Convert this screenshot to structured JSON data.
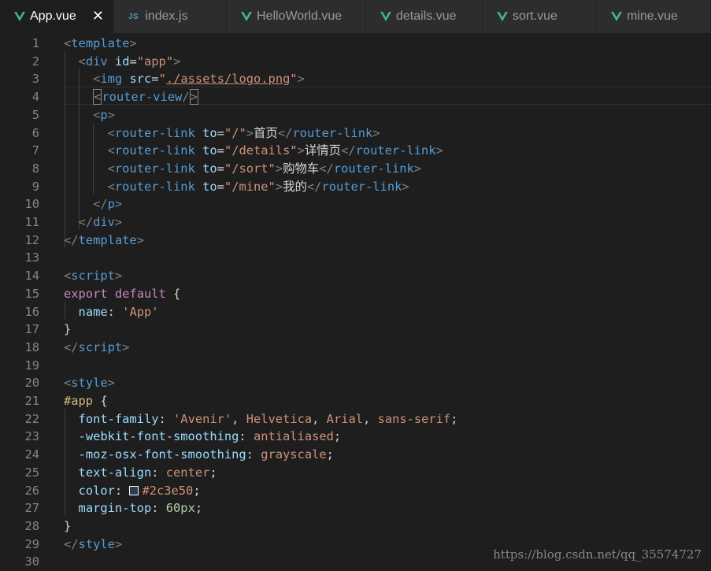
{
  "tabs": [
    {
      "label": "App.vue",
      "icon": "vue-icon",
      "active": true
    },
    {
      "label": "index.js",
      "icon": "js-icon",
      "icon_text": "JS",
      "active": false
    },
    {
      "label": "HelloWorld.vue",
      "icon": "vue-icon",
      "active": false
    },
    {
      "label": "details.vue",
      "icon": "vue-icon",
      "active": false
    },
    {
      "label": "sort.vue",
      "icon": "vue-icon",
      "active": false
    },
    {
      "label": "mine.vue",
      "icon": "vue-icon",
      "active": false
    }
  ],
  "close_glyph": "✕",
  "colors": {
    "vue_green": "#41b883",
    "editor_bg": "#1e1e1e",
    "tag_blue": "#569cd6",
    "attr_cyan": "#9cdcfe",
    "string_orange": "#ce9178",
    "keyword_pink": "#c586c0",
    "number_green": "#b5cea8",
    "selector_gold": "#d7ba7d",
    "color_swatch": "#2c3e50"
  },
  "lines": [
    {
      "n": "1",
      "tokens": [
        [
          "br",
          "<"
        ],
        [
          "tag",
          "template"
        ],
        [
          "br",
          ">"
        ]
      ]
    },
    {
      "n": "2",
      "tokens": [
        [
          "text",
          "  "
        ],
        [
          "br",
          "<"
        ],
        [
          "tag",
          "div"
        ],
        [
          "text",
          " "
        ],
        [
          "attr",
          "id"
        ],
        [
          "text",
          "="
        ],
        [
          "str",
          "\"app\""
        ],
        [
          "br",
          ">"
        ]
      ]
    },
    {
      "n": "3",
      "tokens": [
        [
          "text",
          "    "
        ],
        [
          "br",
          "<"
        ],
        [
          "tag",
          "img"
        ],
        [
          "text",
          " "
        ],
        [
          "attr",
          "src"
        ],
        [
          "text",
          "="
        ],
        [
          "str",
          "\""
        ],
        [
          "link",
          "./assets/logo.png"
        ],
        [
          "str",
          "\""
        ],
        [
          "br",
          ">"
        ]
      ]
    },
    {
      "n": "4",
      "tokens": [
        [
          "text",
          "    "
        ],
        [
          "brbox",
          "<"
        ],
        [
          "tag",
          "router-view"
        ],
        [
          "br",
          "/"
        ],
        [
          "brbox",
          ">"
        ]
      ]
    },
    {
      "n": "5",
      "tokens": [
        [
          "text",
          "    "
        ],
        [
          "br",
          "<"
        ],
        [
          "tag",
          "p"
        ],
        [
          "br",
          ">"
        ]
      ]
    },
    {
      "n": "6",
      "tokens": [
        [
          "text",
          "      "
        ],
        [
          "br",
          "<"
        ],
        [
          "tag",
          "router-link"
        ],
        [
          "text",
          " "
        ],
        [
          "attr",
          "to"
        ],
        [
          "text",
          "="
        ],
        [
          "str",
          "\"/\""
        ],
        [
          "br",
          ">"
        ],
        [
          "cjk",
          "首页"
        ],
        [
          "br",
          "</"
        ],
        [
          "tag",
          "router-link"
        ],
        [
          "br",
          ">"
        ]
      ]
    },
    {
      "n": "7",
      "tokens": [
        [
          "text",
          "      "
        ],
        [
          "br",
          "<"
        ],
        [
          "tag",
          "router-link"
        ],
        [
          "text",
          " "
        ],
        [
          "attr",
          "to"
        ],
        [
          "text",
          "="
        ],
        [
          "str",
          "\"/details\""
        ],
        [
          "br",
          ">"
        ],
        [
          "cjk",
          "详情页"
        ],
        [
          "br",
          "</"
        ],
        [
          "tag",
          "router-link"
        ],
        [
          "br",
          ">"
        ]
      ]
    },
    {
      "n": "8",
      "tokens": [
        [
          "text",
          "      "
        ],
        [
          "br",
          "<"
        ],
        [
          "tag",
          "router-link"
        ],
        [
          "text",
          " "
        ],
        [
          "attr",
          "to"
        ],
        [
          "text",
          "="
        ],
        [
          "str",
          "\"/sort\""
        ],
        [
          "br",
          ">"
        ],
        [
          "cjk",
          "购物车"
        ],
        [
          "br",
          "</"
        ],
        [
          "tag",
          "router-link"
        ],
        [
          "br",
          ">"
        ]
      ]
    },
    {
      "n": "9",
      "tokens": [
        [
          "text",
          "      "
        ],
        [
          "br",
          "<"
        ],
        [
          "tag",
          "router-link"
        ],
        [
          "text",
          " "
        ],
        [
          "attr",
          "to"
        ],
        [
          "text",
          "="
        ],
        [
          "str",
          "\"/mine\""
        ],
        [
          "br",
          ">"
        ],
        [
          "cjk",
          "我的"
        ],
        [
          "br",
          "</"
        ],
        [
          "tag",
          "router-link"
        ],
        [
          "br",
          ">"
        ]
      ]
    },
    {
      "n": "10",
      "tokens": [
        [
          "text",
          "    "
        ],
        [
          "br",
          "</"
        ],
        [
          "tag",
          "p"
        ],
        [
          "br",
          ">"
        ]
      ]
    },
    {
      "n": "11",
      "tokens": [
        [
          "text",
          "  "
        ],
        [
          "br",
          "</"
        ],
        [
          "tag",
          "div"
        ],
        [
          "br",
          ">"
        ]
      ]
    },
    {
      "n": "12",
      "tokens": [
        [
          "br",
          "</"
        ],
        [
          "tag",
          "template"
        ],
        [
          "br",
          ">"
        ]
      ]
    },
    {
      "n": "13",
      "tokens": []
    },
    {
      "n": "14",
      "tokens": [
        [
          "br",
          "<"
        ],
        [
          "tag",
          "script"
        ],
        [
          "br",
          ">"
        ]
      ]
    },
    {
      "n": "15",
      "tokens": [
        [
          "kw",
          "export"
        ],
        [
          "text",
          " "
        ],
        [
          "kw",
          "default"
        ],
        [
          "text",
          " {"
        ]
      ]
    },
    {
      "n": "16",
      "tokens": [
        [
          "text",
          "  "
        ],
        [
          "prop",
          "name"
        ],
        [
          "text",
          ": "
        ],
        [
          "str",
          "'App'"
        ]
      ]
    },
    {
      "n": "17",
      "tokens": [
        [
          "text",
          "}"
        ]
      ]
    },
    {
      "n": "18",
      "tokens": [
        [
          "br",
          "</"
        ],
        [
          "tag",
          "script"
        ],
        [
          "br",
          ">"
        ]
      ]
    },
    {
      "n": "19",
      "tokens": []
    },
    {
      "n": "20",
      "tokens": [
        [
          "br",
          "<"
        ],
        [
          "tag",
          "style"
        ],
        [
          "br",
          ">"
        ]
      ]
    },
    {
      "n": "21",
      "tokens": [
        [
          "sel",
          "#app"
        ],
        [
          "text",
          " {"
        ]
      ]
    },
    {
      "n": "22",
      "tokens": [
        [
          "text",
          "  "
        ],
        [
          "prop",
          "font-family"
        ],
        [
          "text",
          ": "
        ],
        [
          "str",
          "'Avenir'"
        ],
        [
          "text",
          ", "
        ],
        [
          "val",
          "Helvetica"
        ],
        [
          "text",
          ", "
        ],
        [
          "val",
          "Arial"
        ],
        [
          "text",
          ", "
        ],
        [
          "val",
          "sans-serif"
        ],
        [
          "text",
          ";"
        ]
      ]
    },
    {
      "n": "23",
      "tokens": [
        [
          "text",
          "  "
        ],
        [
          "prop",
          "-webkit-font-smoothing"
        ],
        [
          "text",
          ": "
        ],
        [
          "val",
          "antialiased"
        ],
        [
          "text",
          ";"
        ]
      ]
    },
    {
      "n": "24",
      "tokens": [
        [
          "text",
          "  "
        ],
        [
          "prop",
          "-moz-osx-font-smoothing"
        ],
        [
          "text",
          ": "
        ],
        [
          "val",
          "grayscale"
        ],
        [
          "text",
          ";"
        ]
      ]
    },
    {
      "n": "25",
      "tokens": [
        [
          "text",
          "  "
        ],
        [
          "prop",
          "text-align"
        ],
        [
          "text",
          ": "
        ],
        [
          "val",
          "center"
        ],
        [
          "text",
          ";"
        ]
      ]
    },
    {
      "n": "26",
      "tokens": [
        [
          "text",
          "  "
        ],
        [
          "prop",
          "color"
        ],
        [
          "text",
          ": "
        ],
        [
          "swatch",
          ""
        ],
        [
          "val",
          "#2c3e50"
        ],
        [
          "text",
          ";"
        ]
      ]
    },
    {
      "n": "27",
      "tokens": [
        [
          "text",
          "  "
        ],
        [
          "prop",
          "margin-top"
        ],
        [
          "text",
          ": "
        ],
        [
          "num",
          "60px"
        ],
        [
          "text",
          ";"
        ]
      ]
    },
    {
      "n": "28",
      "tokens": [
        [
          "text",
          "}"
        ]
      ]
    },
    {
      "n": "29",
      "tokens": [
        [
          "br",
          "</"
        ],
        [
          "tag",
          "style"
        ],
        [
          "br",
          ">"
        ]
      ]
    },
    {
      "n": "30",
      "tokens": []
    }
  ],
  "watermark": "https://blog.csdn.net/qq_35574727"
}
